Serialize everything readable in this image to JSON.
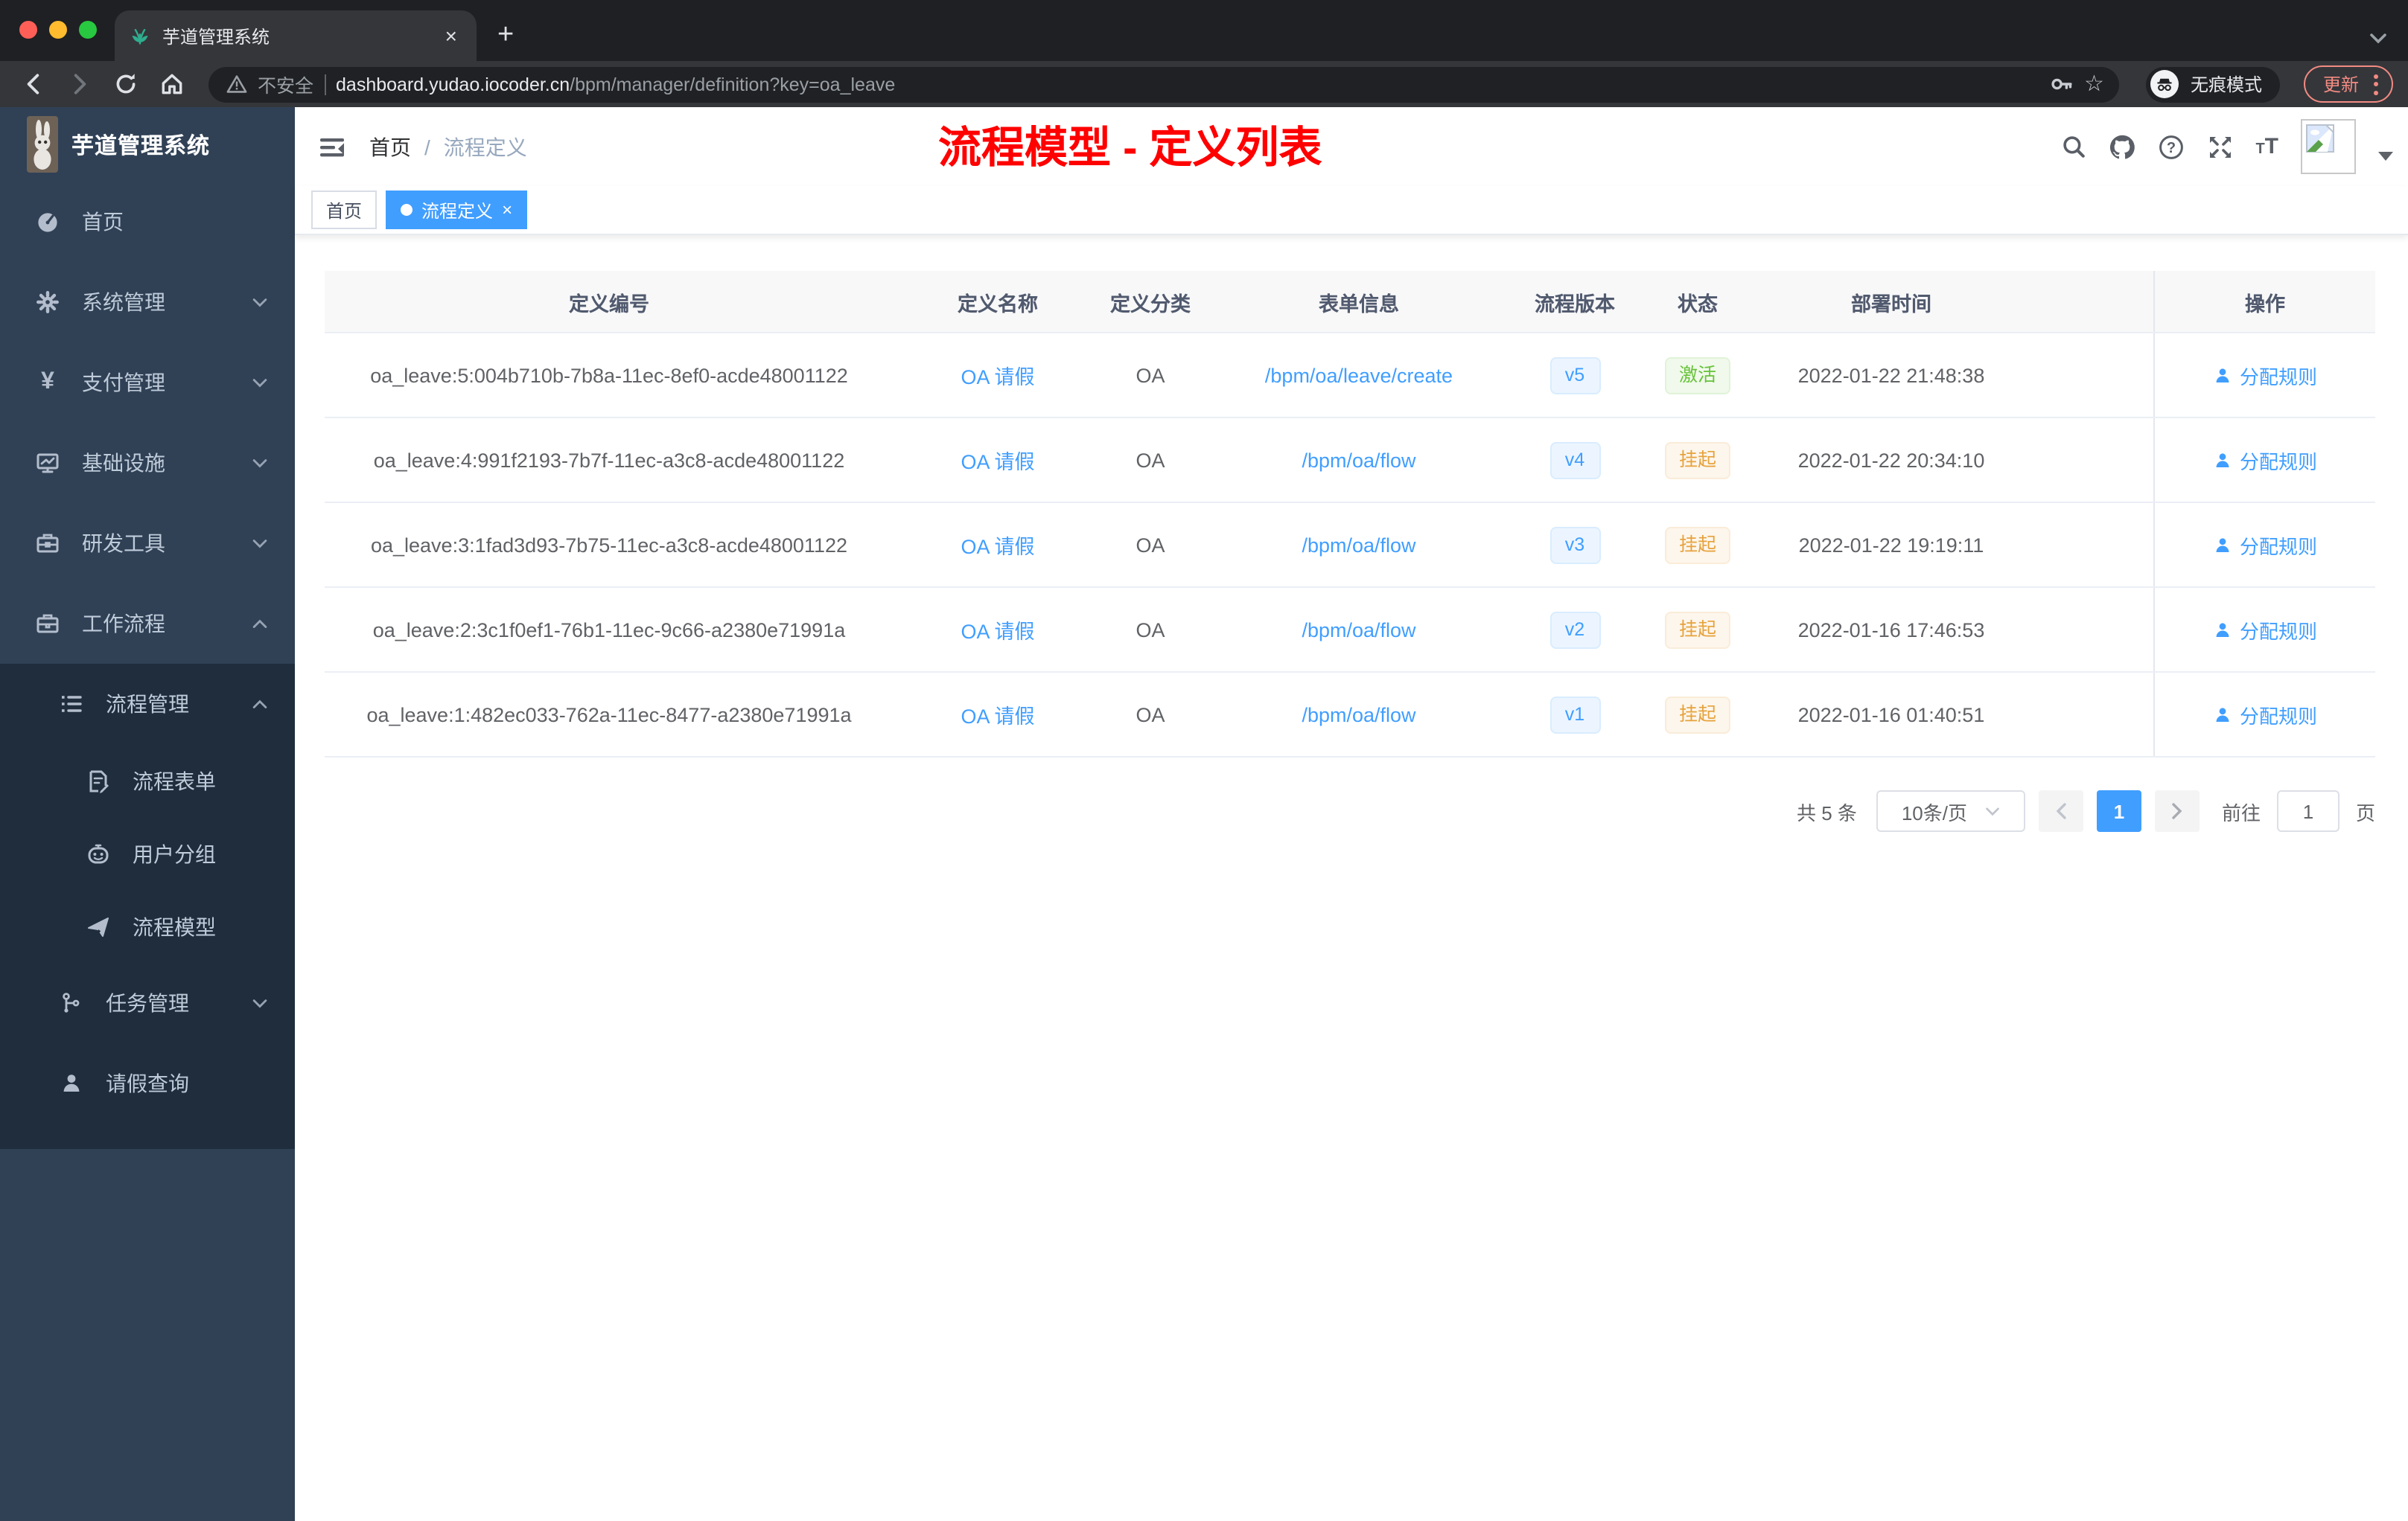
{
  "browser": {
    "tab_title": "芋道管理系统",
    "tab_close": "×",
    "new_tab": "+",
    "security_label": "不安全",
    "url_host": "dashboard.yudao.iocoder.cn",
    "url_path": "/bpm/manager/definition?key=oa_leave",
    "incognito_label": "无痕模式",
    "update_label": "更新"
  },
  "sidebar": {
    "logo_title": "芋道管理系统",
    "menu": [
      {
        "label": "首页"
      },
      {
        "label": "系统管理"
      },
      {
        "label": "支付管理"
      },
      {
        "label": "基础设施"
      },
      {
        "label": "研发工具"
      },
      {
        "label": "工作流程"
      }
    ],
    "submenu": [
      {
        "label": "流程管理"
      },
      {
        "label": "流程表单"
      },
      {
        "label": "用户分组"
      },
      {
        "label": "流程模型"
      },
      {
        "label": "任务管理"
      },
      {
        "label": "请假查询"
      }
    ]
  },
  "navbar": {
    "breadcrumb_home": "首页",
    "breadcrumb_sep": "/",
    "breadcrumb_current": "流程定义",
    "annotation": "流程模型 - 定义列表"
  },
  "tags": {
    "home_label": "首页",
    "active_label": "流程定义",
    "active_close": "×"
  },
  "table": {
    "columns": [
      "定义编号",
      "定义名称",
      "定义分类",
      "表单信息",
      "流程版本",
      "状态",
      "部署时间",
      "操作"
    ],
    "rows": [
      {
        "id": "oa_leave:5:004b710b-7b8a-11ec-8ef0-acde48001122",
        "name": "OA 请假",
        "category": "OA",
        "form": "/bpm/oa/leave/create",
        "version": "v5",
        "status": "激活",
        "status_type": "success",
        "time": "2022-01-22 21:48:38",
        "action": "分配规则"
      },
      {
        "id": "oa_leave:4:991f2193-7b7f-11ec-a3c8-acde48001122",
        "name": "OA 请假",
        "category": "OA",
        "form": "/bpm/oa/flow",
        "version": "v4",
        "status": "挂起",
        "status_type": "warning",
        "time": "2022-01-22 20:34:10",
        "action": "分配规则"
      },
      {
        "id": "oa_leave:3:1fad3d93-7b75-11ec-a3c8-acde48001122",
        "name": "OA 请假",
        "category": "OA",
        "form": "/bpm/oa/flow",
        "version": "v3",
        "status": "挂起",
        "status_type": "warning",
        "time": "2022-01-22 19:19:11",
        "action": "分配规则"
      },
      {
        "id": "oa_leave:2:3c1f0ef1-76b1-11ec-9c66-a2380e71991a",
        "name": "OA 请假",
        "category": "OA",
        "form": "/bpm/oa/flow",
        "version": "v2",
        "status": "挂起",
        "status_type": "warning",
        "time": "2022-01-16 17:46:53",
        "action": "分配规则"
      },
      {
        "id": "oa_leave:1:482ec033-762a-11ec-8477-a2380e71991a",
        "name": "OA 请假",
        "category": "OA",
        "form": "/bpm/oa/flow",
        "version": "v1",
        "status": "挂起",
        "status_type": "warning",
        "time": "2022-01-16 01:40:51",
        "action": "分配规则"
      }
    ]
  },
  "pagination": {
    "total_label": "共 5 条",
    "page_size_label": "10条/页",
    "current_page": "1",
    "goto_label": "前往",
    "goto_value": "1",
    "page_unit_label": "页"
  },
  "colors": {
    "accent_blue": "#409eff",
    "success_green": "#67c23a",
    "warning_orange": "#e6a23c",
    "annotation_red": "#ff0000",
    "sidebar_bg": "#304156",
    "submenu_bg": "#1f2d3d"
  }
}
